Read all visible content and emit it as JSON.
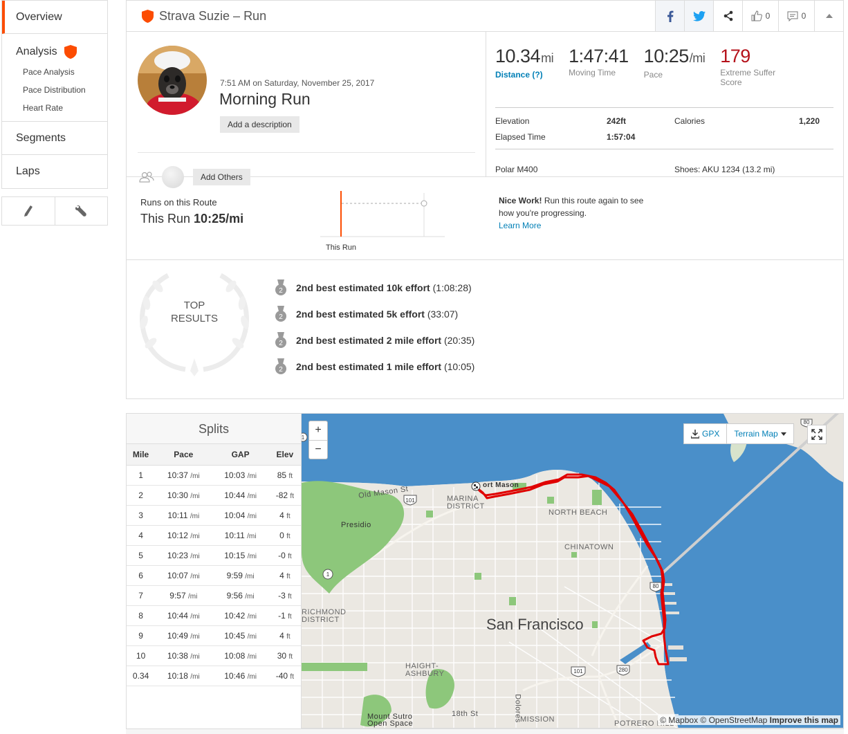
{
  "sidebar": {
    "overview": "Overview",
    "analysis": "Analysis",
    "sub_items": [
      "Pace Analysis",
      "Pace Distribution",
      "Heart Rate"
    ],
    "segments": "Segments",
    "laps": "Laps",
    "accent_color": "#fc4c02",
    "tool_icons": [
      "pencil-icon",
      "wrench-icon"
    ]
  },
  "header": {
    "title": "Strava Suzie – Run",
    "kudos_count": "0",
    "comment_count": "0"
  },
  "activity": {
    "datetime": "7:51 AM on Saturday, November 25, 2017",
    "name": "Morning Run",
    "add_description": "Add a description",
    "add_others": "Add Others"
  },
  "stats": {
    "distance_value": "10.34",
    "distance_unit": "mi",
    "distance_label": "Distance (?)",
    "moving_time_value": "1:47:41",
    "moving_time_label": "Moving Time",
    "pace_value": "10:25",
    "pace_unit": "/mi",
    "pace_label": "Pace",
    "suffer_value": "179",
    "suffer_label": "Extreme Suffer Score",
    "elevation_label": "Elevation",
    "elevation_value": "242ft",
    "elapsed_label": "Elapsed Time",
    "elapsed_value": "1:57:04",
    "calories_label": "Calories",
    "calories_value": "1,220",
    "device": "Polar M400",
    "shoes": "Shoes: AKU 1234 (13.2 mi)",
    "suffer_color": "#b5121b"
  },
  "route": {
    "title": "Runs on this Route",
    "this_run_label": "This Run",
    "this_run_pace": "10:25/mi",
    "chart_label": "This Run",
    "nice_bold": "Nice Work!",
    "nice_text": "Run this route again to see how you're progressing.",
    "learn_more": "Learn More"
  },
  "results": {
    "title_line1": "TOP",
    "title_line2": "RESULTS",
    "items": [
      {
        "rank": "2",
        "label": "2nd best estimated 10k effort",
        "time": "(1:08:28)"
      },
      {
        "rank": "2",
        "label": "2nd best estimated 5k effort",
        "time": "(33:07)"
      },
      {
        "rank": "2",
        "label": "2nd best estimated 2 mile effort",
        "time": "(20:35)"
      },
      {
        "rank": "2",
        "label": "2nd best estimated 1 mile effort",
        "time": "(10:05)"
      }
    ]
  },
  "splits": {
    "title": "Splits",
    "columns": [
      "Mile",
      "Pace",
      "GAP",
      "Elev"
    ],
    "pace_unit": "/mi",
    "elev_unit": "ft",
    "rows": [
      {
        "mile": "1",
        "pace": "10:37",
        "gap": "10:03",
        "elev": "85"
      },
      {
        "mile": "2",
        "pace": "10:30",
        "gap": "10:44",
        "elev": "-82"
      },
      {
        "mile": "3",
        "pace": "10:11",
        "gap": "10:04",
        "elev": "4"
      },
      {
        "mile": "4",
        "pace": "10:12",
        "gap": "10:11",
        "elev": "0"
      },
      {
        "mile": "5",
        "pace": "10:23",
        "gap": "10:15",
        "elev": "-0"
      },
      {
        "mile": "6",
        "pace": "10:07",
        "gap": "9:59",
        "elev": "4"
      },
      {
        "mile": "7",
        "pace": "9:57",
        "gap": "9:56",
        "elev": "-3"
      },
      {
        "mile": "8",
        "pace": "10:44",
        "gap": "10:42",
        "elev": "-1"
      },
      {
        "mile": "9",
        "pace": "10:49",
        "gap": "10:45",
        "elev": "4"
      },
      {
        "mile": "10",
        "pace": "10:38",
        "gap": "10:08",
        "elev": "30"
      },
      {
        "mile": "0.34",
        "pace": "10:18",
        "gap": "10:46",
        "elev": "-40"
      }
    ]
  },
  "map": {
    "zoom_in": "+",
    "zoom_out": "−",
    "gpx": "GPX",
    "terrain": "Terrain Map",
    "attribution_1": "© Mapbox © OpenStreetMap",
    "attribution_2": "Improve this map",
    "city": "San Francisco",
    "labels": {
      "fort_mason": "ort Mason",
      "marina": "MARINA DISTRICT",
      "north_beach": "NORTH BEACH",
      "chinatown": "CHINATOWN",
      "presidio": "Presidio",
      "richmond": "RICHMOND DISTRICT",
      "haight": "HAIGHT-ASHBURY",
      "old_mason": "Old Mason St",
      "mount_sutro": "Mount Sutro Open Space",
      "eighteenth": "18th St",
      "mission": "MISSION",
      "potrero": "POTRERO HILL",
      "dolores": "Dolores"
    },
    "shields": [
      "101",
      "1",
      "80",
      "101",
      "280",
      "1",
      "80"
    ],
    "route_color": "#e00000",
    "water_color": "#4a8fc9",
    "park_color": "#8dc77b"
  }
}
